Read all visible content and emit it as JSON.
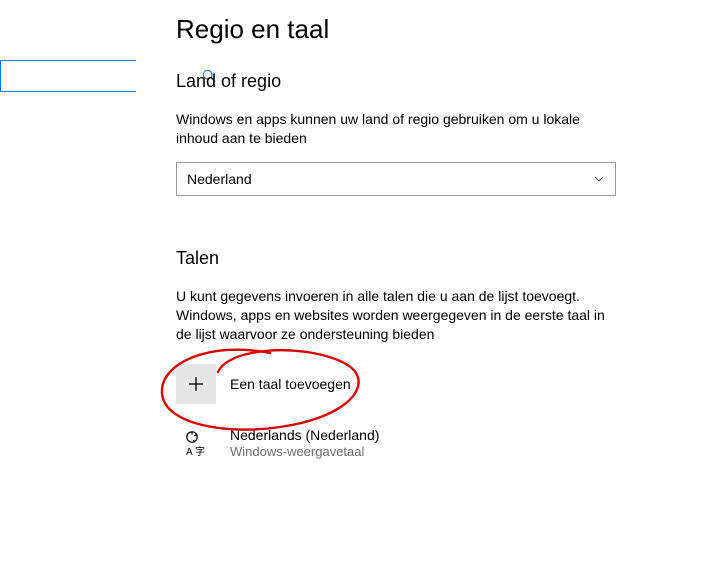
{
  "page": {
    "title": "Regio en taal"
  },
  "search": {
    "value": "",
    "placeholder": ""
  },
  "region": {
    "heading": "Land of regio",
    "desc": "Windows en apps kunnen uw land of regio gebruiken om u lokale inhoud aan te bieden",
    "selected": "Nederland"
  },
  "languages": {
    "heading": "Talen",
    "desc": "U kunt gegevens invoeren in alle talen die u aan de lijst toevoegt. Windows, apps en websites worden weergegeven in de eerste taal in de lijst waarvoor ze ondersteuning bieden",
    "add_label": "Een taal toevoegen",
    "item": {
      "name": "Nederlands (Nederland)",
      "sub": "Windows-weergavetaal"
    }
  }
}
